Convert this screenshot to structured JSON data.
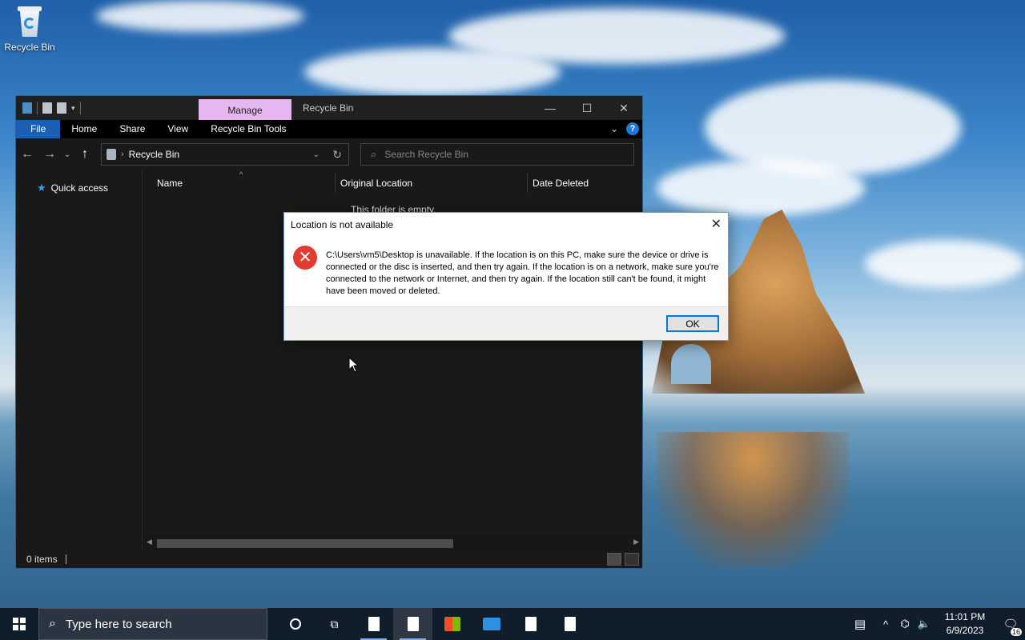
{
  "desktop": {
    "recycle_bin_label": "Recycle Bin"
  },
  "explorer": {
    "ribbon_context_tab": "Manage",
    "window_title": "Recycle Bin",
    "window_controls": {
      "minimize": "—",
      "maximize": "☐",
      "close": "✕"
    },
    "ribbon_tabs": [
      "File",
      "Home",
      "Share",
      "View",
      "Recycle Bin Tools"
    ],
    "address": {
      "path": "Recycle Bin"
    },
    "search": {
      "placeholder": "Search Recycle Bin"
    },
    "nav_pane": {
      "quick_access": "Quick access"
    },
    "columns": [
      "Name",
      "Original Location",
      "Date Deleted"
    ],
    "empty_message": "This folder is empty.",
    "status": {
      "items": "0 items"
    }
  },
  "dialog": {
    "title": "Location is not available",
    "close": "✕",
    "message": "C:\\Users\\vm5\\Desktop is unavailable. If the location is on this PC, make sure the device or drive is connected or the disc is inserted, and then try again. If the location is on a network, make sure you're connected to the network or Internet, and then try again. If the location still can't be found, it might have been moved or deleted.",
    "ok_label": "OK"
  },
  "taskbar": {
    "search_placeholder": "Type here to search",
    "clock": {
      "time": "11:01 PM",
      "date": "6/9/2023"
    },
    "notifications_count": "16"
  },
  "colors": {
    "manage_tab": "#e6b6f0",
    "file_tab": "#1a5fb4",
    "error_red": "#e03c31",
    "accent_blue": "#0078d7"
  }
}
